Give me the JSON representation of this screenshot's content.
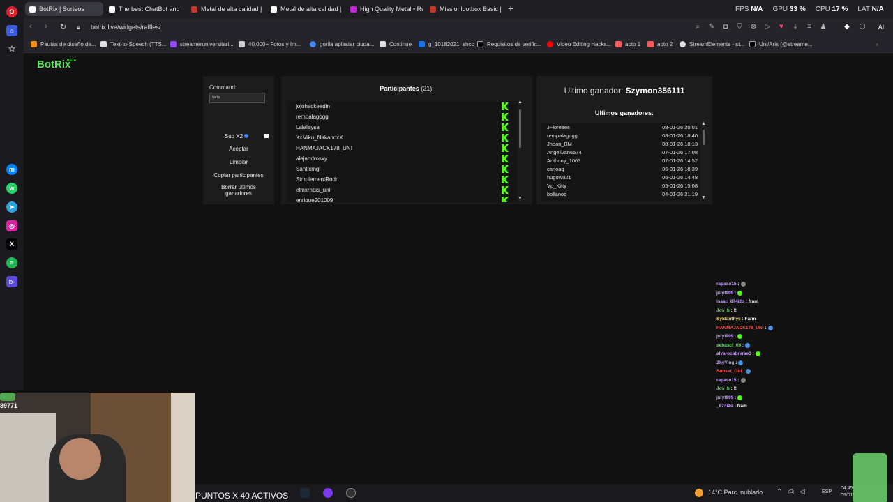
{
  "browser": {
    "tabs": [
      {
        "label": "BotRix | Sorteos",
        "active": true
      },
      {
        "label": "The best ChatBot and Wid",
        "active": false
      },
      {
        "label": "Metal de alta calidad | Ru",
        "active": false
      },
      {
        "label": "Metal de alta calidad | Ru",
        "active": false
      },
      {
        "label": "High Quality Metal • Rust",
        "active": false
      },
      {
        "label": "Missionlootbox Basic | Ru",
        "active": false
      }
    ],
    "new_tab": "+",
    "stats": {
      "fps_label": "FPS",
      "fps_value": "N/A",
      "gpu_label": "GPU",
      "gpu_value": "33 %",
      "cpu_label": "CPU",
      "cpu_value": "17 %",
      "lat_label": "LAT",
      "lat_value": "N/A"
    },
    "url": "botrix.live/widgets/raffles/",
    "ai_label": "AI",
    "bookmarks": [
      "Pautas de diseño de...",
      "Text-to-Speech (TTS...",
      "streameruniversitari...",
      "40.000+ Fotos y Im...",
      "gorila aplastar ciuda...",
      "Continue",
      "g_10182021_shcc",
      "Requisitos de verific...",
      "Video Editing Hacks...",
      "apto 1",
      "apto 2",
      "StreamElements - st...",
      "Uni/Aris (@streame..."
    ]
  },
  "botrix": {
    "logo": "BotRix",
    "logo_badge": "BETA",
    "command_label": "Command:",
    "command_value": "!aris",
    "sub_label": "Sub X2",
    "buttons": {
      "accept": "Aceptar",
      "clear": "Limpiar",
      "copy": "Copiar participantes",
      "delete": "Borrar ultimos ganadores"
    },
    "participants_title": "Participantes",
    "participants_count": "(21):",
    "participants": [
      "jojohackeadin",
      "rempalagogg",
      "Lalalaysa",
      "XxMiku_NakanoxX",
      "HANMAJACK178_UNI",
      "alejandrosxy",
      "Santixmgl",
      "SimplementRodri",
      "elmxrhtss_uni",
      "enrique201009"
    ],
    "last_winner_label": "Ultimo ganador:",
    "last_winner_name": "Szymon356111",
    "winners_title": "Ultimos ganadores:",
    "winners": [
      {
        "name": "JFloreees",
        "date": "08-01-26 20:01"
      },
      {
        "name": "rempalagogg",
        "date": "08-01-26 18:40"
      },
      {
        "name": "Jhoan_BM",
        "date": "08-01-26 18:13"
      },
      {
        "name": "Angelivan6574",
        "date": "07-01-26 17:08"
      },
      {
        "name": "Anthony_1003",
        "date": "07-01-26 14:52"
      },
      {
        "name": "carjoaq",
        "date": "06-01-26 18:39"
      },
      {
        "name": "hugowu21",
        "date": "06-01-26 14:48"
      },
      {
        "name": "Vp_Kitty",
        "date": "05-01-26 15:08"
      },
      {
        "name": "bollanoq",
        "date": "04-01-26 21:19"
      }
    ]
  },
  "chat": [
    {
      "user": "rapaso15",
      "sep": " :",
      "msg": "",
      "color": "#c8a0ff",
      "emote": "#888"
    },
    {
      "user": "julyf999",
      "sep": " :",
      "msg": "",
      "color": "#c8a0ff",
      "emote": "#53fc18"
    },
    {
      "user": "isaac_874i2o",
      "sep": " :",
      "msg": " fram",
      "color": "#c8a0ff",
      "emote": ""
    },
    {
      "user": "Jos_b",
      "sep": " :",
      "msg": " !!",
      "color": "#5ce65c",
      "emote": ""
    },
    {
      "user": "Syldanthys",
      "sep": " :",
      "msg": " Farm",
      "color": "#ffd54a",
      "emote": ""
    },
    {
      "user": "HANMAJACK178_UNI",
      "sep": " :",
      "msg": "",
      "color": "#ff4d4d",
      "emote": "#4a90e2"
    },
    {
      "user": "julyf999",
      "sep": " :",
      "msg": "",
      "color": "#c8a0ff",
      "emote": "#53fc18"
    },
    {
      "user": "sebascf_09",
      "sep": " :",
      "msg": "",
      "color": "#5ce65c",
      "emote": "#4a90e2"
    },
    {
      "user": "alvarocabrerae3",
      "sep": " :",
      "msg": "",
      "color": "#c8a0ff",
      "emote": "#53fc18"
    },
    {
      "user": "ZhyYing",
      "sep": " :",
      "msg": "",
      "color": "#c8a0ff",
      "emote": "#4a90e2"
    },
    {
      "user": "Sunset_Girl",
      "sep": " :",
      "msg": "",
      "color": "#ff4d4d",
      "emote": "#4a90e2"
    },
    {
      "user": "rapaso15",
      "sep": " :",
      "msg": "",
      "color": "#c8a0ff",
      "emote": "#888"
    },
    {
      "user": "Jos_b",
      "sep": " :",
      "msg": " !!",
      "color": "#5ce65c",
      "emote": ""
    },
    {
      "user": "julyf999",
      "sep": " :",
      "msg": "",
      "color": "#c8a0ff",
      "emote": "#53fc18"
    },
    {
      "user": "_874i2o",
      "sep": " :",
      "msg": " fram",
      "color": "#c8a0ff",
      "emote": ""
    }
  ],
  "webcam": {
    "overlay_name": "89771"
  },
  "taskbar": {
    "overlay_text": "PUNTOS X 40 ACTIVOS",
    "weather": "14°C  Parc. nublado",
    "lang": "ESP",
    "time": "04:45",
    "date": "09/01/"
  }
}
